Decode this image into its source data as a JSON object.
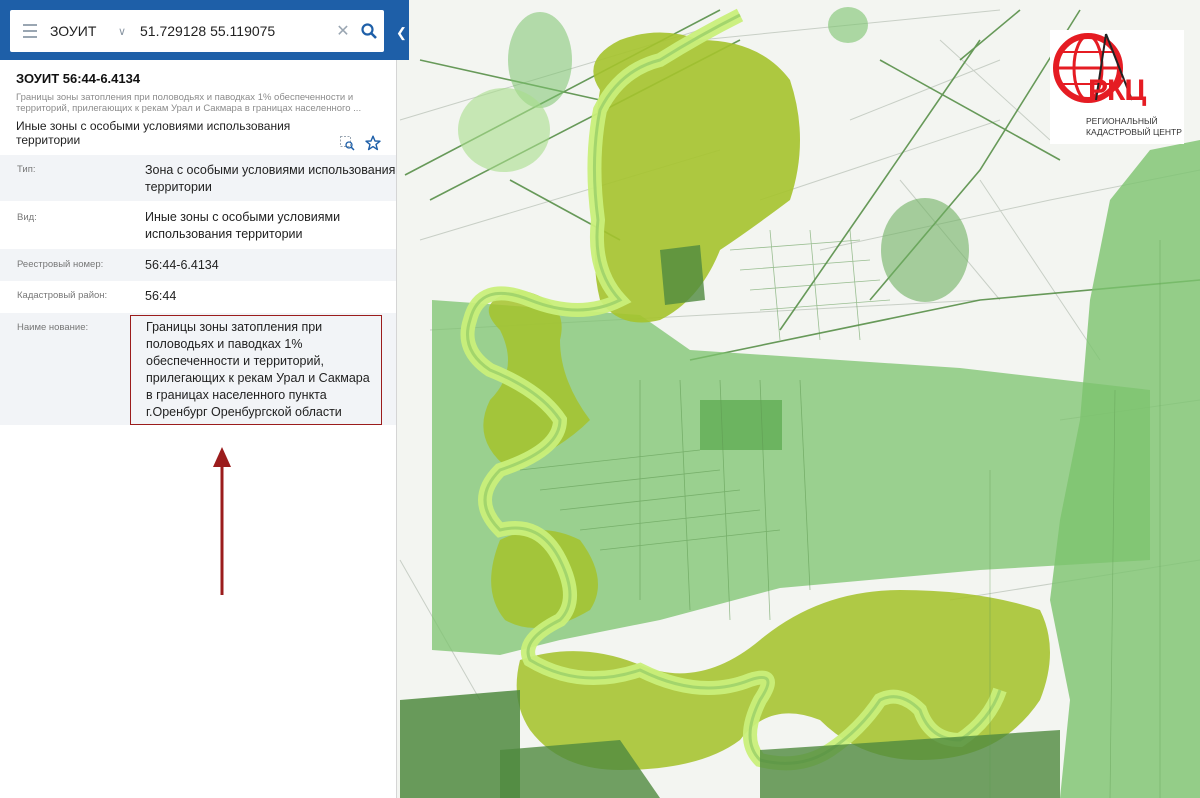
{
  "search": {
    "type_value": "ЗОУИТ",
    "query": "51.729128 55.119075"
  },
  "icons": {
    "menu": "hamburger-menu-icon",
    "type_dropdown": "chevron-down-icon",
    "clear": "close-icon",
    "search": "magnifier-icon",
    "collapse": "chevron-left-icon",
    "zoom_to": "zoom-to-object-icon",
    "favorite": "star-icon"
  },
  "object": {
    "title": "ЗОУИТ 56:44-6.4134",
    "description": "Границы зоны затопления при половодьях и паводках 1% обеспеченности и территорий, прилегающих к рекам Урал и Сакмара в границах населенного ...",
    "subtitle": "Иные зоны с особыми условиями использования территории"
  },
  "properties": [
    {
      "label": "Тип:",
      "value": "Зона с особыми условиями использования территории"
    },
    {
      "label": "Вид:",
      "value": "Иные зоны с особыми условиями использования территории"
    },
    {
      "label": "Реестровый номер:",
      "value": "56:44-6.4134"
    },
    {
      "label": "Кадастровый район:",
      "value": "56:44"
    },
    {
      "label": "Наиме нование:",
      "value": "Границы зоны затопления при половодьях и паводках 1% обеспеченности и территорий, прилегающих к рекам Урал и Сакмара в границах населенного пункта г.Оренбург Оренбургской области"
    }
  ],
  "logo": {
    "abbr": "РКЦ",
    "line1": "РЕГИОНАЛЬНЫЙ",
    "line2": "КАДАСТРОВЫЙ ЦЕНТР"
  },
  "colors": {
    "header_blue": "#1e5fa8",
    "link": "#1f7ab9",
    "highlight_border": "#9b1c1c",
    "arrow": "#9b1c1c",
    "zone_green": "#7cc36e",
    "flood_olive": "#a5c32c",
    "river_light": "#c9ef7a",
    "dark_green": "#4f8a3f",
    "logo_red": "#e51c23"
  }
}
